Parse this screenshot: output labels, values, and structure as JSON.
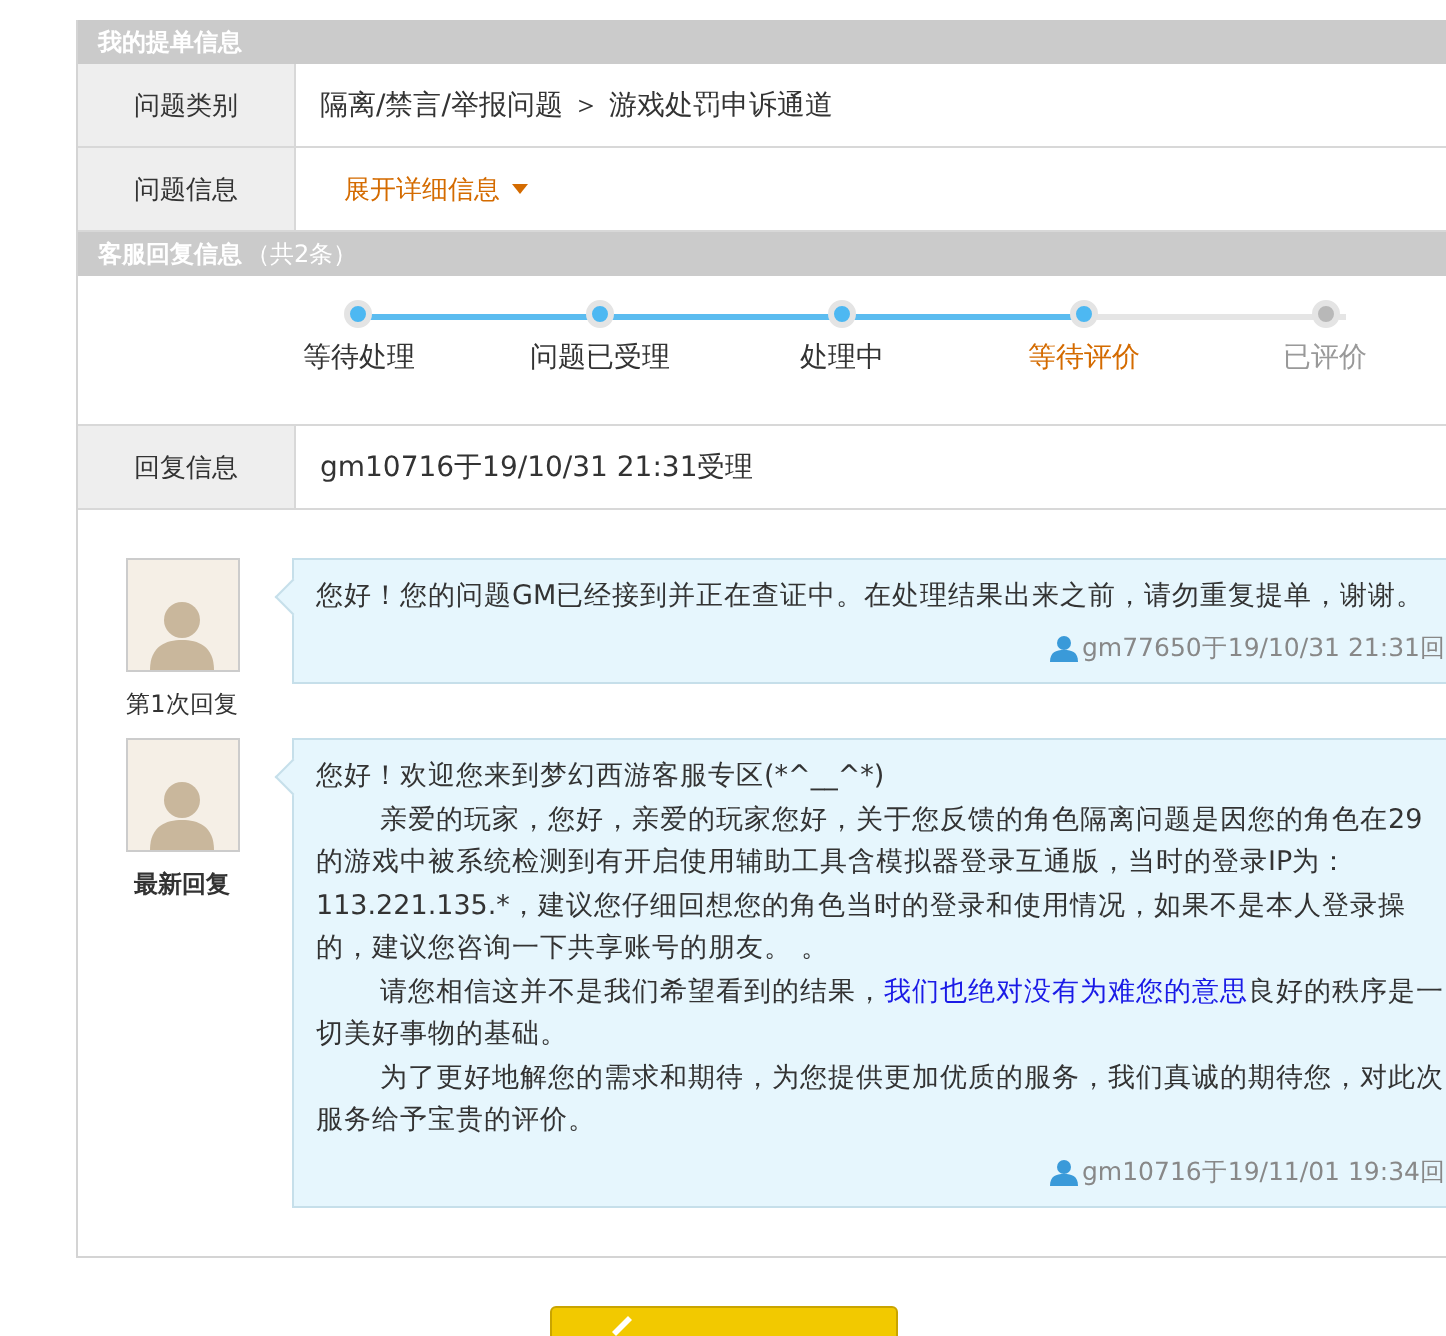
{
  "ticket_section": {
    "title": "我的提单信息",
    "rows": [
      {
        "kind": "text",
        "label": "问题类别",
        "value": "隔离/禁言/举报问题 ＞ 游戏处罚申诉通道"
      },
      {
        "kind": "toggle",
        "label": "问题信息",
        "value": "展开详细信息",
        "expanded": false
      }
    ]
  },
  "reply_section": {
    "title": "客服回复信息",
    "count": "（共2条）",
    "steps": [
      {
        "label": "等待处理",
        "reached": true,
        "selected": false
      },
      {
        "label": "问题已受理",
        "reached": true,
        "selected": false
      },
      {
        "label": "处理中",
        "reached": true,
        "selected": false
      },
      {
        "label": "等待评价",
        "reached": true,
        "selected": true
      },
      {
        "label": "已评价",
        "reached": false,
        "selected": false
      }
    ],
    "info_row": {
      "label": "回复信息",
      "value": "gm10716于19/10/31 21:31受理"
    },
    "replies": [
      {
        "caption": "第1次回复",
        "latest": false,
        "lines": [
          {
            "text": "您好！您的问题GM已经接到并正在查证中。在处理结果出来之前，请勿重复提单，谢谢。",
            "indent": false
          }
        ],
        "signature": "gm77650于19/10/31 21:31回"
      },
      {
        "caption": "最新回复",
        "latest": true,
        "lines": [
          {
            "text": "您好！欢迎您来到梦幻西游客服专区(*^__^*)",
            "indent": false
          },
          {
            "text": "亲爱的玩家，您好，亲爱的玩家您好，关于您反馈的角色隔离问题是因您的角色在29",
            "indent": true
          },
          {
            "text": "的游戏中被系统检测到有开启使用辅助工具含模拟器登录互通版，当时的登录IP为：",
            "indent": false
          },
          {
            "text": "113.221.135.*，建议您仔细回想您的角色当时的登录和使用情况，如果不是本人登录操",
            "indent": false
          },
          {
            "text": "的，建议您咨询一下共享账号的朋友。 。",
            "indent": false
          },
          {
            "text": "请您相信这并不是我们希望看到的结果，",
            "link": "我们也绝对没有为难您的意思",
            "after": "良好的秩序是一",
            "indent": true
          },
          {
            "text": "切美好事物的基础。",
            "indent": false
          },
          {
            "text": "为了更好地解您的需求和期待，为您提供更加优质的服务，我们真诚的期待您，对此次",
            "indent": true
          },
          {
            "text": "服务给予宝贵的评价。",
            "indent": false
          }
        ],
        "signature": "gm10716于19/11/01 19:34回"
      }
    ]
  }
}
